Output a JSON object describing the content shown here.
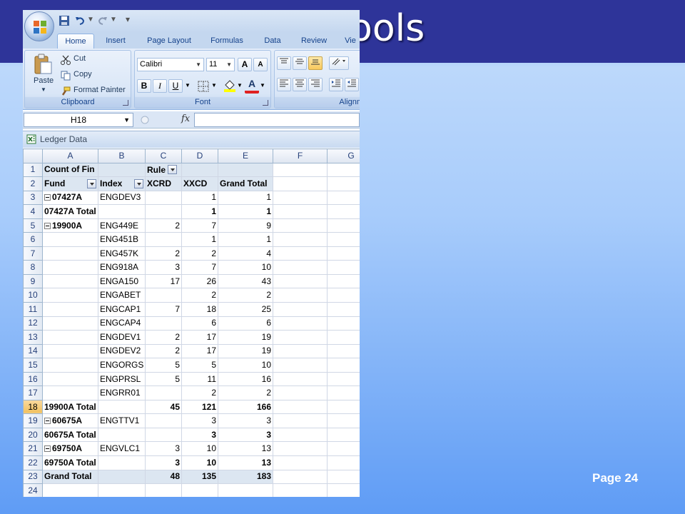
{
  "slide": {
    "title": "ools",
    "page_number": "Page 24"
  },
  "excel": {
    "tabs": [
      "Home",
      "Insert",
      "Page Layout",
      "Formulas",
      "Data",
      "Review",
      "Vie"
    ],
    "clipboard": {
      "paste": "Paste",
      "cut": "Cut",
      "copy": "Copy",
      "format_painter": "Format Painter",
      "label": "Clipboard"
    },
    "font": {
      "name": "Calibri",
      "size": "11",
      "label": "Font",
      "bold": "B",
      "italic": "I",
      "underline": "U",
      "grow": "A",
      "shrink": "A",
      "color": "A"
    },
    "alignment": {
      "label": "Alignm"
    },
    "name_box": "H18",
    "fx": "fx",
    "workbook_title": "Ledger Data",
    "columns": [
      "A",
      "B",
      "C",
      "D",
      "E",
      "F",
      "G"
    ],
    "rows": [
      {
        "n": "1",
        "a": "Count of Fin",
        "b": "",
        "c": "Rule",
        "d": "",
        "e": ""
      },
      {
        "n": "2",
        "a": "Fund",
        "b": "Index",
        "c": "XCRD",
        "d": "XXCD",
        "e": "Grand Total"
      },
      {
        "n": "3",
        "a": "07427A",
        "b": "ENGDEV3",
        "c": "",
        "d": "1",
        "e": "1"
      },
      {
        "n": "4",
        "a": "07427A Total",
        "b": "",
        "c": "",
        "d": "1",
        "e": "1"
      },
      {
        "n": "5",
        "a": "19900A",
        "b": "ENG449E",
        "c": "2",
        "d": "7",
        "e": "9"
      },
      {
        "n": "6",
        "a": "",
        "b": "ENG451B",
        "c": "",
        "d": "1",
        "e": "1"
      },
      {
        "n": "7",
        "a": "",
        "b": "ENG457K",
        "c": "2",
        "d": "2",
        "e": "4"
      },
      {
        "n": "8",
        "a": "",
        "b": "ENG918A",
        "c": "3",
        "d": "7",
        "e": "10"
      },
      {
        "n": "9",
        "a": "",
        "b": "ENGA150",
        "c": "17",
        "d": "26",
        "e": "43"
      },
      {
        "n": "10",
        "a": "",
        "b": "ENGABET",
        "c": "",
        "d": "2",
        "e": "2"
      },
      {
        "n": "11",
        "a": "",
        "b": "ENGCAP1",
        "c": "7",
        "d": "18",
        "e": "25"
      },
      {
        "n": "12",
        "a": "",
        "b": "ENGCAP4",
        "c": "",
        "d": "6",
        "e": "6"
      },
      {
        "n": "13",
        "a": "",
        "b": "ENGDEV1",
        "c": "2",
        "d": "17",
        "e": "19"
      },
      {
        "n": "14",
        "a": "",
        "b": "ENGDEV2",
        "c": "2",
        "d": "17",
        "e": "19"
      },
      {
        "n": "15",
        "a": "",
        "b": "ENGORGS",
        "c": "5",
        "d": "5",
        "e": "10"
      },
      {
        "n": "16",
        "a": "",
        "b": "ENGPRSL",
        "c": "5",
        "d": "11",
        "e": "16"
      },
      {
        "n": "17",
        "a": "",
        "b": "ENGRR01",
        "c": "",
        "d": "2",
        "e": "2"
      },
      {
        "n": "18",
        "a": "19900A Total",
        "b": "",
        "c": "45",
        "d": "121",
        "e": "166"
      },
      {
        "n": "19",
        "a": "60675A",
        "b": "ENGTTV1",
        "c": "",
        "d": "3",
        "e": "3"
      },
      {
        "n": "20",
        "a": "60675A Total",
        "b": "",
        "c": "",
        "d": "3",
        "e": "3"
      },
      {
        "n": "21",
        "a": "69750A",
        "b": "ENGVLC1",
        "c": "3",
        "d": "10",
        "e": "13"
      },
      {
        "n": "22",
        "a": "69750A Total",
        "b": "",
        "c": "3",
        "d": "10",
        "e": "13"
      },
      {
        "n": "23",
        "a": "Grand Total",
        "b": "",
        "c": "48",
        "d": "135",
        "e": "183"
      },
      {
        "n": "24",
        "a": "",
        "b": "",
        "c": "",
        "d": "",
        "e": ""
      }
    ]
  }
}
